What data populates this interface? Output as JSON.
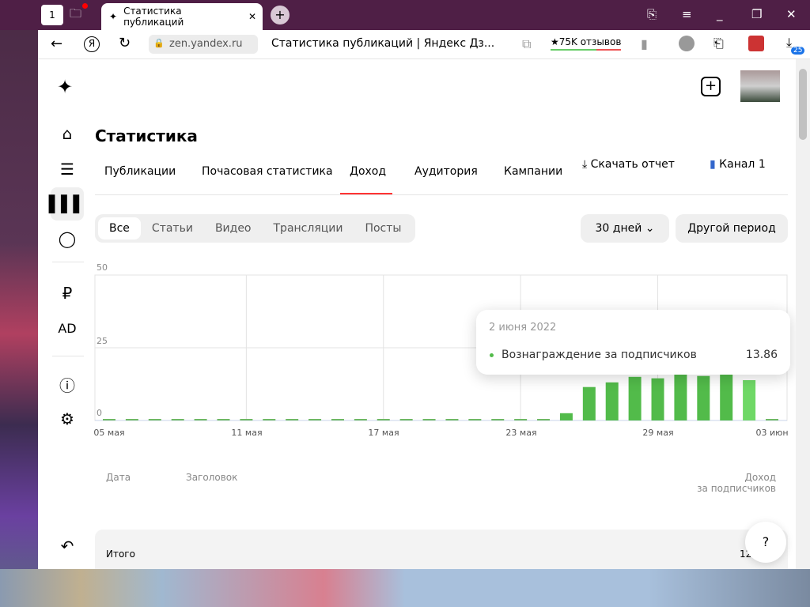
{
  "browser": {
    "tab_counter": "1",
    "tab_title": "Статистика публикаций",
    "url": "zen.yandex.ru",
    "page_title": "Статистика публикаций | Яндекс Дз...",
    "reviews": "★75K отзывов",
    "downloads_badge": "25"
  },
  "header": {
    "title": "Статистика"
  },
  "tabs": [
    {
      "label": "Публикации"
    },
    {
      "label": "Почасовая статистика"
    },
    {
      "label": "Доход",
      "active": true
    },
    {
      "label": "Аудитория"
    },
    {
      "label": "Кампании"
    }
  ],
  "actions": {
    "download": "Скачать отчет",
    "channel": "Канал 1"
  },
  "filters": {
    "types": [
      "Все",
      "Статьи",
      "Видео",
      "Трансляции",
      "Посты"
    ],
    "period": "30 дней",
    "other_period": "Другой период"
  },
  "sidebar": {
    "ad": "AD"
  },
  "chart_data": {
    "type": "bar",
    "ylim": [
      0,
      50
    ],
    "yticks": [
      "0",
      "25",
      "50"
    ],
    "xtick_labels": [
      "05 мая",
      "11 мая",
      "17 мая",
      "23 мая",
      "29 мая",
      "03 июн"
    ],
    "categories": [
      "05 мая",
      "06 мая",
      "07 мая",
      "08 мая",
      "09 мая",
      "10 мая",
      "11 мая",
      "12 мая",
      "13 мая",
      "14 мая",
      "15 мая",
      "16 мая",
      "17 мая",
      "18 мая",
      "19 мая",
      "20 мая",
      "21 мая",
      "22 мая",
      "23 мая",
      "24 мая",
      "25 мая",
      "26 мая",
      "27 мая",
      "28 мая",
      "29 мая",
      "30 мая",
      "31 мая",
      "01 июн",
      "02 июн",
      "03 июн"
    ],
    "values": [
      0,
      0,
      0,
      0,
      0,
      0,
      0,
      0,
      0,
      0,
      0,
      0,
      0,
      0,
      0,
      0,
      0,
      0,
      0,
      0,
      2.5,
      11.5,
      13.1,
      15,
      14.5,
      16,
      15.3,
      15.8,
      13.86,
      0
    ],
    "highlighted": "02 июн",
    "color": "#52bb4a",
    "grid": true,
    "tooltip": {
      "date": "2 июня 2022",
      "series": "Вознаграждение за подписчиков",
      "value": "13.86"
    }
  },
  "table": {
    "columns": [
      "Дата",
      "Заголовок",
      "Доход",
      "за подписчиков"
    ],
    "total_label": "Итого",
    "total_value": "120..."
  },
  "help": "?"
}
